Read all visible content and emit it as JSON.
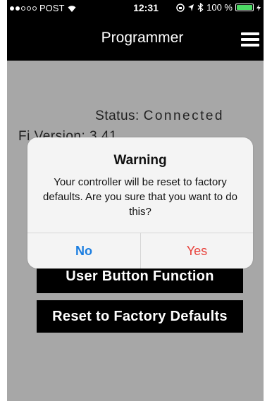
{
  "status_bar": {
    "carrier": "POST",
    "time": "12:31",
    "battery_percent": "100 %",
    "battery_level": 1.0
  },
  "navbar": {
    "title": "Programmer",
    "menu_icon": "hamburger-menu-icon"
  },
  "content": {
    "status_label": "Status:",
    "status_value": "Connected",
    "firmware_partial": "Fi           Version: 3.41"
  },
  "buttons": {
    "user_button_function": "User Button Function",
    "reset_factory_defaults": "Reset to Factory Defaults"
  },
  "alert": {
    "title": "Warning",
    "message": "Your controller will be reset to factory defaults. Are you sure that you want to do this?",
    "no_label": "No",
    "yes_label": "Yes"
  },
  "colors": {
    "accent_blue": "#1a7de0",
    "destructive_red": "#e8403a",
    "background_gray": "#a7a7a7",
    "battery_green": "#4cd964"
  }
}
